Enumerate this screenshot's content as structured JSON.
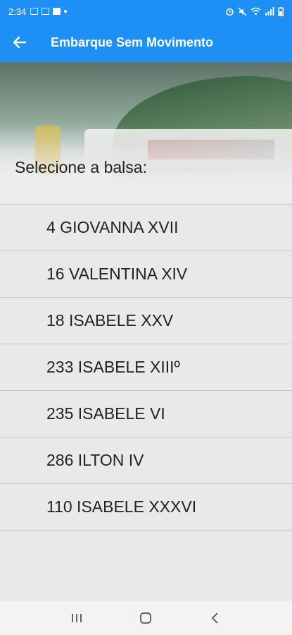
{
  "status_bar": {
    "time": "2:34",
    "icons_left": [
      "image-icon",
      "cast-icon",
      "facebook-icon",
      "dot-icon"
    ],
    "icons_right": [
      "alarm-icon",
      "mute-icon",
      "wifi-icon",
      "signal-icon",
      "battery-icon"
    ]
  },
  "app_bar": {
    "title": "Embarque Sem Movimento",
    "color": "#1e90f5"
  },
  "hero": {
    "label": "Selecione a balsa:"
  },
  "ferries": [
    {
      "label": "4 GIOVANNA XVII"
    },
    {
      "label": "16 VALENTINA XIV"
    },
    {
      "label": "18 ISABELE XXV"
    },
    {
      "label": "233 ISABELE XIIIº"
    },
    {
      "label": "235 ISABELE VI"
    },
    {
      "label": "286 ILTON IV"
    },
    {
      "label": "110 ISABELE XXXVI"
    }
  ],
  "nav_bar": {
    "buttons": [
      "recent-apps-icon",
      "home-icon",
      "back-icon"
    ]
  }
}
